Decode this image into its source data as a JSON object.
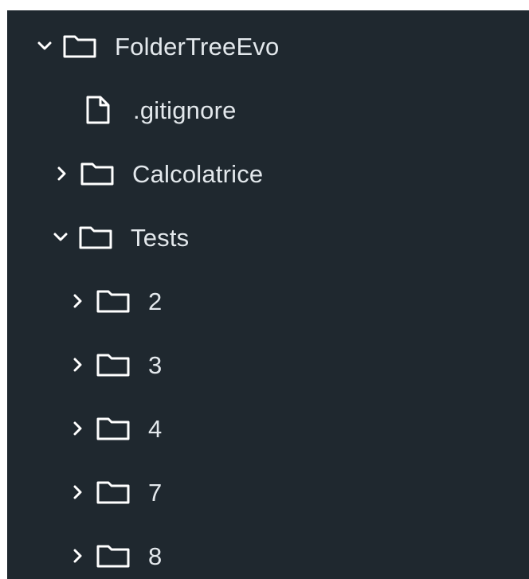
{
  "colors": {
    "background": "#1f282f",
    "text": "#e3e8ec",
    "icon_stroke": "#ffffff"
  },
  "tree": {
    "items": [
      {
        "label": "FolderTreeEvo",
        "type": "folder",
        "expanded": true,
        "depth": 0,
        "chevron_icon": "chevron-down-icon",
        "item_icon": "folder-icon"
      },
      {
        "label": ".gitignore",
        "type": "file",
        "depth": 1,
        "item_icon": "file-icon"
      },
      {
        "label": "Calcolatrice",
        "type": "folder",
        "expanded": false,
        "depth": 1,
        "chevron_icon": "chevron-right-icon",
        "item_icon": "folder-icon"
      },
      {
        "label": "Tests",
        "type": "folder",
        "expanded": true,
        "depth": 1,
        "chevron_icon": "chevron-down-icon",
        "item_icon": "folder-icon"
      },
      {
        "label": "2",
        "type": "folder",
        "expanded": false,
        "depth": 2,
        "chevron_icon": "chevron-right-icon",
        "item_icon": "folder-icon"
      },
      {
        "label": "3",
        "type": "folder",
        "expanded": false,
        "depth": 2,
        "chevron_icon": "chevron-right-icon",
        "item_icon": "folder-icon"
      },
      {
        "label": "4",
        "type": "folder",
        "expanded": false,
        "depth": 2,
        "chevron_icon": "chevron-right-icon",
        "item_icon": "folder-icon"
      },
      {
        "label": "7",
        "type": "folder",
        "expanded": false,
        "depth": 2,
        "chevron_icon": "chevron-right-icon",
        "item_icon": "folder-icon"
      },
      {
        "label": "8",
        "type": "folder",
        "expanded": false,
        "depth": 2,
        "chevron_icon": "chevron-right-icon",
        "item_icon": "folder-icon"
      }
    ]
  }
}
